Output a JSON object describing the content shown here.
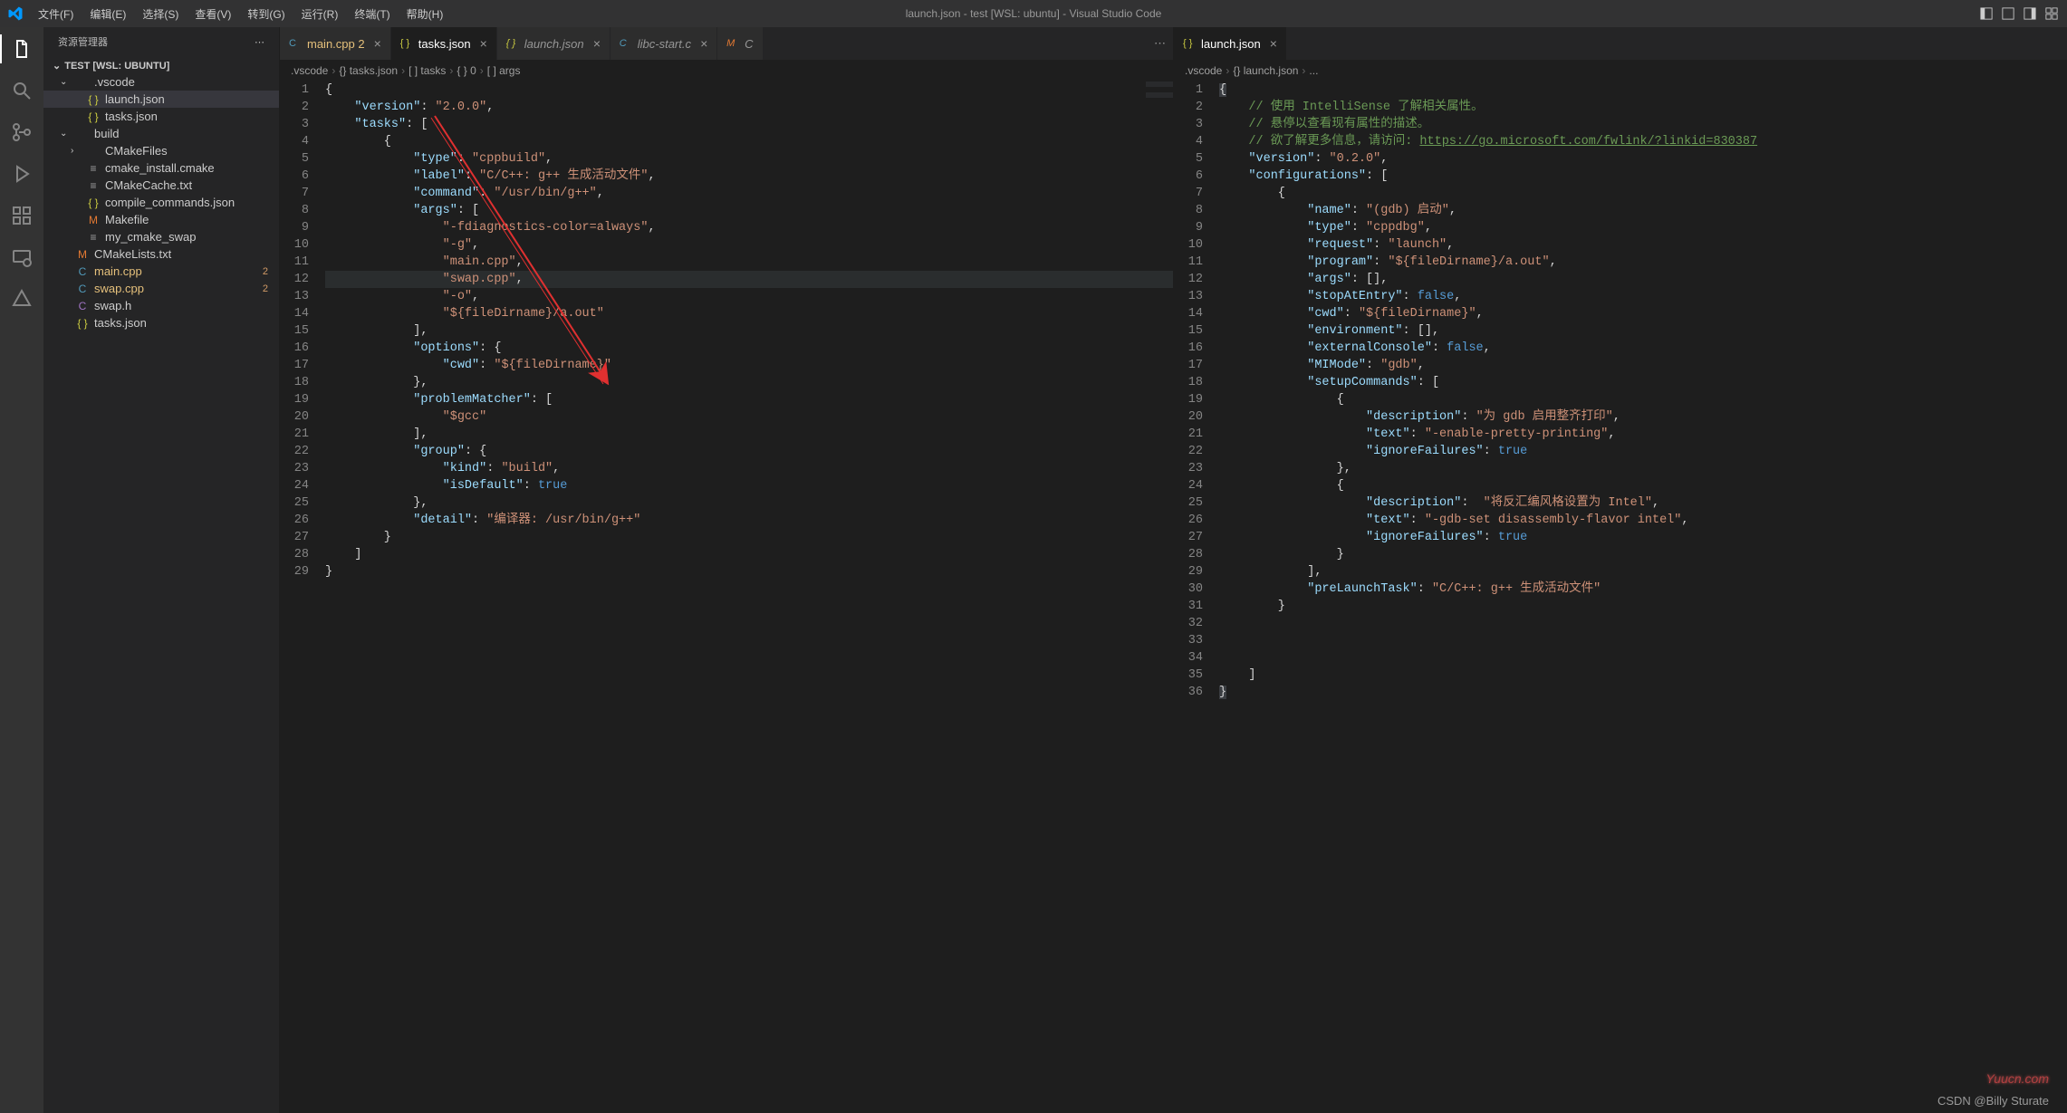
{
  "titlebar": {
    "menus": [
      "文件(F)",
      "编辑(E)",
      "选择(S)",
      "查看(V)",
      "转到(G)",
      "运行(R)",
      "终端(T)",
      "帮助(H)"
    ],
    "title": "launch.json - test [WSL: ubuntu] - Visual Studio Code"
  },
  "sidebar": {
    "title": "资源管理器",
    "section": "TEST [WSL: UBUNTU]",
    "tree": [
      {
        "type": "folder",
        "label": ".vscode",
        "indent": 0,
        "open": true,
        "icon": "folder"
      },
      {
        "type": "file",
        "label": "launch.json",
        "indent": 1,
        "icon": "json",
        "selected": true
      },
      {
        "type": "file",
        "label": "tasks.json",
        "indent": 1,
        "icon": "json"
      },
      {
        "type": "folder",
        "label": "build",
        "indent": 0,
        "open": true,
        "icon": "folder"
      },
      {
        "type": "folder",
        "label": "CMakeFiles",
        "indent": 1,
        "open": false,
        "icon": "folder"
      },
      {
        "type": "file",
        "label": "cmake_install.cmake",
        "indent": 1,
        "icon": "txt"
      },
      {
        "type": "file",
        "label": "CMakeCache.txt",
        "indent": 1,
        "icon": "txt"
      },
      {
        "type": "file",
        "label": "compile_commands.json",
        "indent": 1,
        "icon": "json"
      },
      {
        "type": "file",
        "label": "Makefile",
        "indent": 1,
        "icon": "make"
      },
      {
        "type": "file",
        "label": "my_cmake_swap",
        "indent": 1,
        "icon": "txt"
      },
      {
        "type": "file",
        "label": "CMakeLists.txt",
        "indent": 0,
        "icon": "make"
      },
      {
        "type": "file",
        "label": "main.cpp",
        "indent": 0,
        "icon": "cpp",
        "badge": "2",
        "badgeColor": "#e5c07b"
      },
      {
        "type": "file",
        "label": "swap.cpp",
        "indent": 0,
        "icon": "cpp",
        "badge": "2",
        "badgeColor": "#e5c07b"
      },
      {
        "type": "file",
        "label": "swap.h",
        "indent": 0,
        "icon": "h"
      },
      {
        "type": "file",
        "label": "tasks.json",
        "indent": 0,
        "icon": "json"
      }
    ]
  },
  "editorLeft": {
    "tabs": [
      {
        "label": "main.cpp",
        "icon": "cpp",
        "modified": true,
        "badge": "2"
      },
      {
        "label": "tasks.json",
        "icon": "json",
        "active": true
      },
      {
        "label": "launch.json",
        "icon": "json",
        "italic": true
      },
      {
        "label": "libc-start.c",
        "icon": "c",
        "italic": true
      },
      {
        "label": "C",
        "icon": "make",
        "short": true
      }
    ],
    "breadcrumbs": [
      ".vscode",
      "{} tasks.json",
      "[ ] tasks",
      "{ } 0",
      "[ ] args"
    ],
    "code": {
      "lines": [
        {
          "n": 1,
          "html": "{"
        },
        {
          "n": 2,
          "html": "    <span class='tk-key'>\"version\"</span>: <span class='tk-str'>\"2.0.0\"</span>,"
        },
        {
          "n": 3,
          "html": "    <span class='tk-key'>\"tasks\"</span>: ["
        },
        {
          "n": 4,
          "html": "        {"
        },
        {
          "n": 5,
          "html": "            <span class='tk-key'>\"type\"</span>: <span class='tk-str'>\"cppbuild\"</span>,"
        },
        {
          "n": 6,
          "html": "            <span class='tk-key'>\"label\"</span>: <span class='tk-str'>\"C/C++: g++ 生成活动文件\"</span>,"
        },
        {
          "n": 7,
          "html": "            <span class='tk-key'>\"command\"</span>: <span class='tk-str'>\"/usr/bin/g++\"</span>,"
        },
        {
          "n": 8,
          "html": "            <span class='tk-key'>\"args\"</span>: ["
        },
        {
          "n": 9,
          "html": "                <span class='tk-str'>\"-fdiagnostics-color=always\"</span>,"
        },
        {
          "n": 10,
          "html": "                <span class='tk-str'>\"-g\"</span>,"
        },
        {
          "n": 11,
          "html": "                <span class='tk-str'>\"main.cpp\"</span>,"
        },
        {
          "n": 12,
          "html": "                <span class='tk-str'>\"swap.cpp\"</span>,",
          "hl": true
        },
        {
          "n": 13,
          "html": "                <span class='tk-str'>\"-o\"</span>,"
        },
        {
          "n": 14,
          "html": "                <span class='tk-str'>\"${fileDirname}/a.out\"</span>"
        },
        {
          "n": 15,
          "html": "            ],"
        },
        {
          "n": 16,
          "html": "            <span class='tk-key'>\"options\"</span>: {"
        },
        {
          "n": 17,
          "html": "                <span class='tk-key'>\"cwd\"</span>: <span class='tk-str'>\"${fileDirname}\"</span>"
        },
        {
          "n": 18,
          "html": "            },"
        },
        {
          "n": 19,
          "html": "            <span class='tk-key'>\"problemMatcher\"</span>: ["
        },
        {
          "n": 20,
          "html": "                <span class='tk-str'>\"$gcc\"</span>"
        },
        {
          "n": 21,
          "html": "            ],"
        },
        {
          "n": 22,
          "html": "            <span class='tk-key'>\"group\"</span>: {"
        },
        {
          "n": 23,
          "html": "                <span class='tk-key'>\"kind\"</span>: <span class='tk-str'>\"build\"</span>,"
        },
        {
          "n": 24,
          "html": "                <span class='tk-key'>\"isDefault\"</span>: <span class='tk-bool'>true</span>"
        },
        {
          "n": 25,
          "html": "            },"
        },
        {
          "n": 26,
          "html": "            <span class='tk-key'>\"detail\"</span>: <span class='tk-str'>\"编译器: /usr/bin/g++\"</span>"
        },
        {
          "n": 27,
          "html": "        }"
        },
        {
          "n": 28,
          "html": "    ]"
        },
        {
          "n": 29,
          "html": "}"
        }
      ]
    }
  },
  "editorRight": {
    "tabs": [
      {
        "label": "launch.json",
        "icon": "json",
        "active": true
      }
    ],
    "breadcrumbs": [
      ".vscode",
      "{} launch.json",
      "..."
    ],
    "code": {
      "lines": [
        {
          "n": 1,
          "html": "<span style='background:#3a3d41'>{</span>"
        },
        {
          "n": 2,
          "html": "    <span class='tk-comment'>// 使用 IntelliSense 了解相关属性。</span>"
        },
        {
          "n": 3,
          "html": "    <span class='tk-comment'>// 悬停以查看现有属性的描述。</span>"
        },
        {
          "n": 4,
          "html": "    <span class='tk-comment'>// 欲了解更多信息，请访问: <span class='tk-link'>https://go.microsoft.com/fwlink/?linkid=830387</span></span>"
        },
        {
          "n": 5,
          "html": "    <span class='tk-key'>\"version\"</span>: <span class='tk-str'>\"0.2.0\"</span>,"
        },
        {
          "n": 6,
          "html": "    <span class='tk-key'>\"configurations\"</span>: ["
        },
        {
          "n": 7,
          "html": "        {"
        },
        {
          "n": 8,
          "html": "            <span class='tk-key'>\"name\"</span>: <span class='tk-str'>\"(gdb) 启动\"</span>,"
        },
        {
          "n": 9,
          "html": "            <span class='tk-key'>\"type\"</span>: <span class='tk-str'>\"cppdbg\"</span>,"
        },
        {
          "n": 10,
          "html": "            <span class='tk-key'>\"request\"</span>: <span class='tk-str'>\"launch\"</span>,"
        },
        {
          "n": 11,
          "html": "            <span class='tk-key'>\"program\"</span>: <span class='tk-str'>\"${fileDirname}/a.out\"</span>,"
        },
        {
          "n": 12,
          "html": "            <span class='tk-key'>\"args\"</span>: [],"
        },
        {
          "n": 13,
          "html": "            <span class='tk-key'>\"stopAtEntry\"</span>: <span class='tk-bool'>false</span>,"
        },
        {
          "n": 14,
          "html": "            <span class='tk-key'>\"cwd\"</span>: <span class='tk-str'>\"${fileDirname}\"</span>,"
        },
        {
          "n": 15,
          "html": "            <span class='tk-key'>\"environment\"</span>: [],"
        },
        {
          "n": 16,
          "html": "            <span class='tk-key'>\"externalConsole\"</span>: <span class='tk-bool'>false</span>,"
        },
        {
          "n": 17,
          "html": "            <span class='tk-key'>\"MIMode\"</span>: <span class='tk-str'>\"gdb\"</span>,"
        },
        {
          "n": 18,
          "html": "            <span class='tk-key'>\"setupCommands\"</span>: ["
        },
        {
          "n": 19,
          "html": "                {"
        },
        {
          "n": 20,
          "html": "                    <span class='tk-key'>\"description\"</span>: <span class='tk-str'>\"为 gdb 启用整齐打印\"</span>,"
        },
        {
          "n": 21,
          "html": "                    <span class='tk-key'>\"text\"</span>: <span class='tk-str'>\"-enable-pretty-printing\"</span>,"
        },
        {
          "n": 22,
          "html": "                    <span class='tk-key'>\"ignoreFailures\"</span>: <span class='tk-bool'>true</span>"
        },
        {
          "n": 23,
          "html": "                },"
        },
        {
          "n": 24,
          "html": "                {"
        },
        {
          "n": 25,
          "html": "                    <span class='tk-key'>\"description\"</span>:  <span class='tk-str'>\"将反汇编风格设置为 Intel\"</span>,"
        },
        {
          "n": 26,
          "html": "                    <span class='tk-key'>\"text\"</span>: <span class='tk-str'>\"-gdb-set disassembly-flavor intel\"</span>,"
        },
        {
          "n": 27,
          "html": "                    <span class='tk-key'>\"ignoreFailures\"</span>: <span class='tk-bool'>true</span>"
        },
        {
          "n": 28,
          "html": "                }"
        },
        {
          "n": 29,
          "html": "            ],"
        },
        {
          "n": 30,
          "html": "            <span class='tk-key'>\"preLaunchTask\"</span>: <span class='tk-str'>\"C/C++: g++ 生成活动文件\"</span>"
        },
        {
          "n": 31,
          "html": "        }"
        },
        {
          "n": 32,
          "html": ""
        },
        {
          "n": 33,
          "html": ""
        },
        {
          "n": 34,
          "html": ""
        },
        {
          "n": 35,
          "html": "    ]"
        },
        {
          "n": 36,
          "html": "<span style='background:#3a3d41'>}</span>"
        }
      ]
    }
  },
  "watermark1": "Yuucn.com",
  "watermark2": "CSDN @Billy Sturate"
}
